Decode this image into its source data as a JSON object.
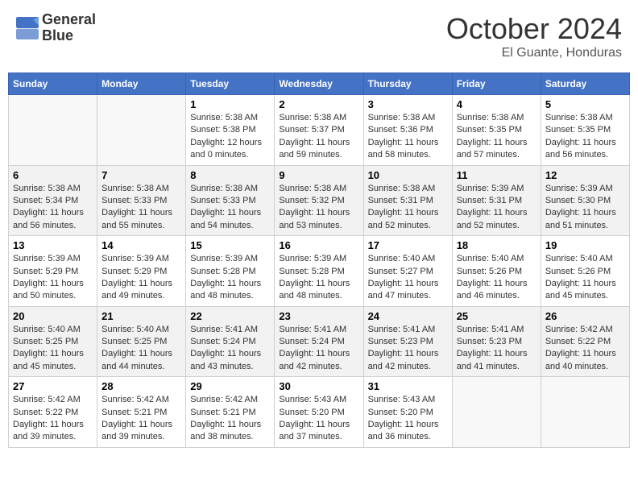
{
  "header": {
    "logo_line1": "General",
    "logo_line2": "Blue",
    "month": "October 2024",
    "location": "El Guante, Honduras"
  },
  "weekdays": [
    "Sunday",
    "Monday",
    "Tuesday",
    "Wednesday",
    "Thursday",
    "Friday",
    "Saturday"
  ],
  "weeks": [
    [
      {
        "day": "",
        "info": ""
      },
      {
        "day": "",
        "info": ""
      },
      {
        "day": "1",
        "info": "Sunrise: 5:38 AM\nSunset: 5:38 PM\nDaylight: 12 hours\nand 0 minutes."
      },
      {
        "day": "2",
        "info": "Sunrise: 5:38 AM\nSunset: 5:37 PM\nDaylight: 11 hours\nand 59 minutes."
      },
      {
        "day": "3",
        "info": "Sunrise: 5:38 AM\nSunset: 5:36 PM\nDaylight: 11 hours\nand 58 minutes."
      },
      {
        "day": "4",
        "info": "Sunrise: 5:38 AM\nSunset: 5:35 PM\nDaylight: 11 hours\nand 57 minutes."
      },
      {
        "day": "5",
        "info": "Sunrise: 5:38 AM\nSunset: 5:35 PM\nDaylight: 11 hours\nand 56 minutes."
      }
    ],
    [
      {
        "day": "6",
        "info": "Sunrise: 5:38 AM\nSunset: 5:34 PM\nDaylight: 11 hours\nand 56 minutes."
      },
      {
        "day": "7",
        "info": "Sunrise: 5:38 AM\nSunset: 5:33 PM\nDaylight: 11 hours\nand 55 minutes."
      },
      {
        "day": "8",
        "info": "Sunrise: 5:38 AM\nSunset: 5:33 PM\nDaylight: 11 hours\nand 54 minutes."
      },
      {
        "day": "9",
        "info": "Sunrise: 5:38 AM\nSunset: 5:32 PM\nDaylight: 11 hours\nand 53 minutes."
      },
      {
        "day": "10",
        "info": "Sunrise: 5:38 AM\nSunset: 5:31 PM\nDaylight: 11 hours\nand 52 minutes."
      },
      {
        "day": "11",
        "info": "Sunrise: 5:39 AM\nSunset: 5:31 PM\nDaylight: 11 hours\nand 52 minutes."
      },
      {
        "day": "12",
        "info": "Sunrise: 5:39 AM\nSunset: 5:30 PM\nDaylight: 11 hours\nand 51 minutes."
      }
    ],
    [
      {
        "day": "13",
        "info": "Sunrise: 5:39 AM\nSunset: 5:29 PM\nDaylight: 11 hours\nand 50 minutes."
      },
      {
        "day": "14",
        "info": "Sunrise: 5:39 AM\nSunset: 5:29 PM\nDaylight: 11 hours\nand 49 minutes."
      },
      {
        "day": "15",
        "info": "Sunrise: 5:39 AM\nSunset: 5:28 PM\nDaylight: 11 hours\nand 48 minutes."
      },
      {
        "day": "16",
        "info": "Sunrise: 5:39 AM\nSunset: 5:28 PM\nDaylight: 11 hours\nand 48 minutes."
      },
      {
        "day": "17",
        "info": "Sunrise: 5:40 AM\nSunset: 5:27 PM\nDaylight: 11 hours\nand 47 minutes."
      },
      {
        "day": "18",
        "info": "Sunrise: 5:40 AM\nSunset: 5:26 PM\nDaylight: 11 hours\nand 46 minutes."
      },
      {
        "day": "19",
        "info": "Sunrise: 5:40 AM\nSunset: 5:26 PM\nDaylight: 11 hours\nand 45 minutes."
      }
    ],
    [
      {
        "day": "20",
        "info": "Sunrise: 5:40 AM\nSunset: 5:25 PM\nDaylight: 11 hours\nand 45 minutes."
      },
      {
        "day": "21",
        "info": "Sunrise: 5:40 AM\nSunset: 5:25 PM\nDaylight: 11 hours\nand 44 minutes."
      },
      {
        "day": "22",
        "info": "Sunrise: 5:41 AM\nSunset: 5:24 PM\nDaylight: 11 hours\nand 43 minutes."
      },
      {
        "day": "23",
        "info": "Sunrise: 5:41 AM\nSunset: 5:24 PM\nDaylight: 11 hours\nand 42 minutes."
      },
      {
        "day": "24",
        "info": "Sunrise: 5:41 AM\nSunset: 5:23 PM\nDaylight: 11 hours\nand 42 minutes."
      },
      {
        "day": "25",
        "info": "Sunrise: 5:41 AM\nSunset: 5:23 PM\nDaylight: 11 hours\nand 41 minutes."
      },
      {
        "day": "26",
        "info": "Sunrise: 5:42 AM\nSunset: 5:22 PM\nDaylight: 11 hours\nand 40 minutes."
      }
    ],
    [
      {
        "day": "27",
        "info": "Sunrise: 5:42 AM\nSunset: 5:22 PM\nDaylight: 11 hours\nand 39 minutes."
      },
      {
        "day": "28",
        "info": "Sunrise: 5:42 AM\nSunset: 5:21 PM\nDaylight: 11 hours\nand 39 minutes."
      },
      {
        "day": "29",
        "info": "Sunrise: 5:42 AM\nSunset: 5:21 PM\nDaylight: 11 hours\nand 38 minutes."
      },
      {
        "day": "30",
        "info": "Sunrise: 5:43 AM\nSunset: 5:20 PM\nDaylight: 11 hours\nand 37 minutes."
      },
      {
        "day": "31",
        "info": "Sunrise: 5:43 AM\nSunset: 5:20 PM\nDaylight: 11 hours\nand 36 minutes."
      },
      {
        "day": "",
        "info": ""
      },
      {
        "day": "",
        "info": ""
      }
    ]
  ]
}
